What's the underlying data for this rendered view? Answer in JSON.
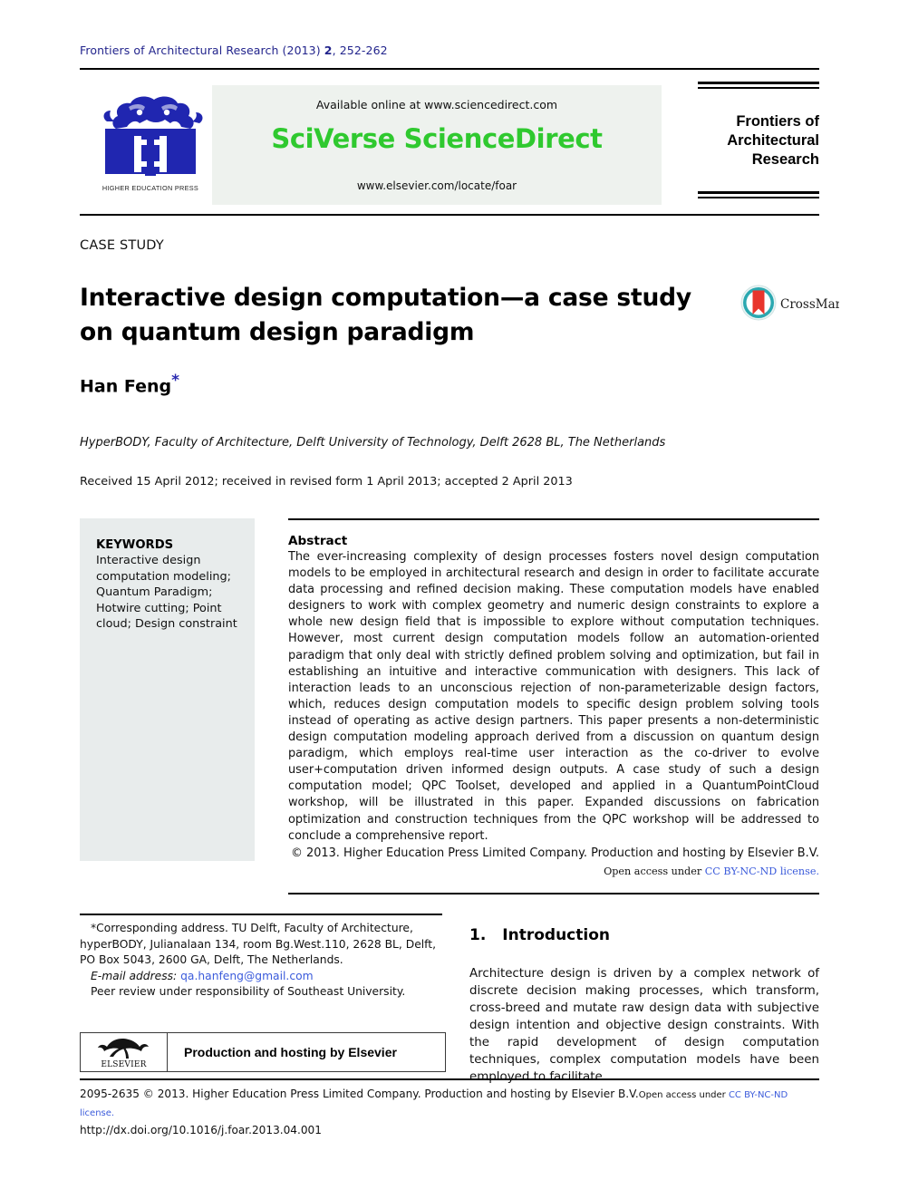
{
  "running_head": {
    "journal_issue": "Frontiers of Architectural Research (2013)",
    "volume": "2",
    "pages": ", 252-262"
  },
  "masthead": {
    "publisher_logo_caption": "HIGHER EDUCATION PRESS",
    "available_online": "Available online at www.sciencedirect.com",
    "platform_brand": "SciVerse ScienceDirect",
    "journal_url": "www.elsevier.com/locate/foar",
    "journal_title_line1": "Frontiers of",
    "journal_title_line2": "Architectural",
    "journal_title_line3": "Research",
    "brand_color": "#2fc92f",
    "box_color": "#eef2ee"
  },
  "article": {
    "type_label": "CASE STUDY",
    "title": "Interactive design computation—a case study on quantum design paradigm",
    "crossmark_label": "CrossMark",
    "author": "Han Feng",
    "author_marker": "*",
    "affiliation": "HyperBODY, Faculty of Architecture, Delft University of Technology, Delft 2628 BL, The Netherlands",
    "history": "Received 15 April 2012; received in revised form 1 April 2013; accepted 2 April 2013"
  },
  "keywords": {
    "heading": "KEYWORDS",
    "items": "Interactive design computation modeling; Quantum Paradigm; Hotwire cutting; Point cloud; Design constraint"
  },
  "abstract": {
    "heading": "Abstract",
    "body": "The ever-increasing complexity of design processes fosters novel design computation models to be employed in architectural research and design in order to facilitate accurate data processing and refined decision making. These computation models have enabled designers to work with complex geometry and numeric design constraints to explore a whole new design field that is impossible to explore without computation techniques. However, most current design computation models follow an automation-oriented paradigm that only deal with strictly defined problem solving and optimization, but fail in establishing an intuitive and interactive communication with designers. This lack of interaction leads to an unconscious rejection of non-parameterizable design factors, which, reduces design computation models to specific design problem solving tools instead of operating as active design partners. This paper presents a non-deterministic design computation modeling approach derived from a discussion on quantum design paradigm, which employs real-time user interaction as the co-driver to evolve user+computation driven informed design outputs. A case study of such a design computation model; QPC Toolset, developed and applied in a QuantumPointCloud workshop, will be illustrated in this paper. Expanded discussions on fabrication optimization and construction techniques from the QPC workshop will be addressed to conclude a comprehensive report.",
    "copyright": "© 2013. Higher Education Press Limited Company. Production and hosting by Elsevier B.V.",
    "open_access_prefix": "Open access under ",
    "open_access_link": "CC BY-NC-ND license.",
    "link_color": "#3b5bdb"
  },
  "footnote": {
    "corresponding": "*Corresponding address. TU Delft, Faculty of Architecture, hyperBODY, Julianalaan 134, room Bg.West.110, 2628 BL, Delft, PO Box 5043, 2600 GA, Delft, The Netherlands.",
    "email_label": "E-mail address:",
    "email": "qa.hanfeng@gmail.com",
    "peer_review": "Peer review under responsibility of Southeast University."
  },
  "elsevier_box": {
    "logo_word": "ELSEVIER",
    "text": "Production and hosting by Elsevier"
  },
  "introduction": {
    "number": "1.",
    "heading": "Introduction",
    "paragraph": "Architecture design is driven by a complex network of discrete decision making processes, which transform, cross-breed and mutate raw design data with subjective design intention and objective design constraints. With the rapid development of design computation techniques, complex computation models have been employed to facilitate"
  },
  "page_footer": {
    "issn_line": "2095-2635 © 2013. Higher Education Press Limited Company. Production and hosting by Elsevier B.V.",
    "open_access_prefix": "Open access under ",
    "open_access_link": "CC BY-NC-ND license.",
    "doi": "http://dx.doi.org/10.1016/j.foar.2013.04.001"
  }
}
